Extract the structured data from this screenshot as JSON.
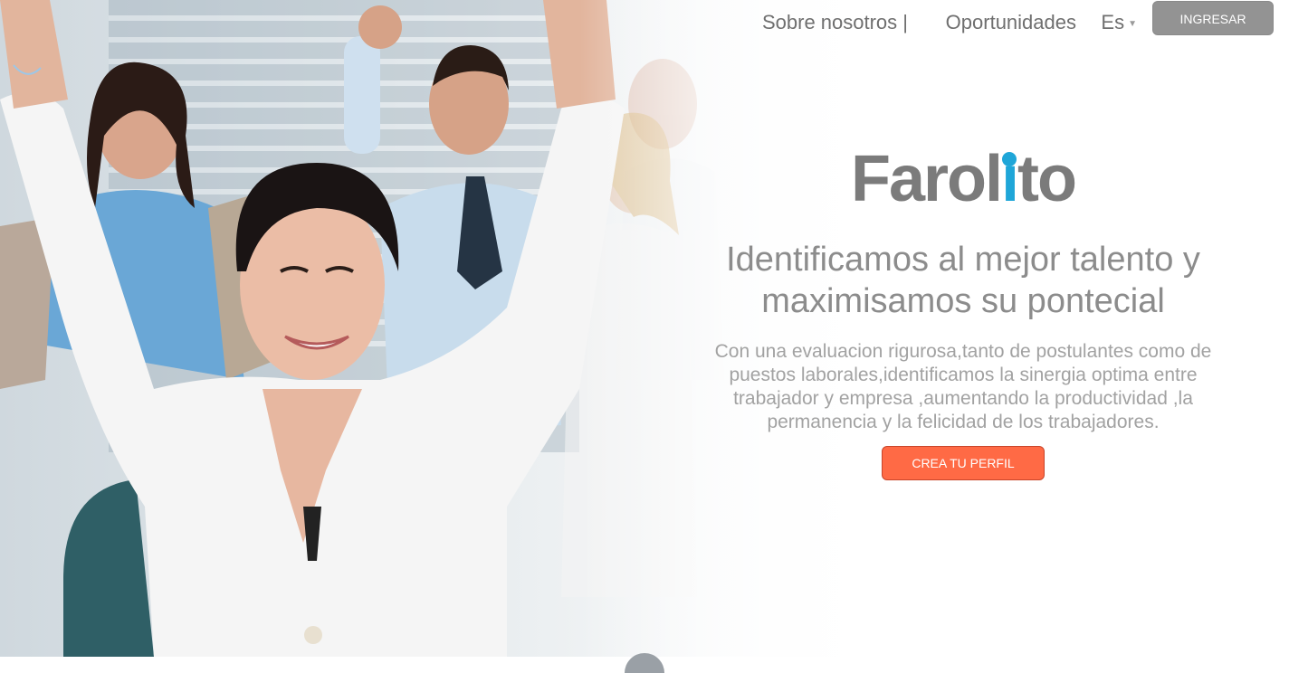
{
  "nav": {
    "about": "Sobre nosotros |",
    "opportunities": "Oportunidades",
    "language": "Es",
    "login": "INGRESAR"
  },
  "hero": {
    "logo_text": "Farolito",
    "logo_prefix": "Farol",
    "logo_i": "ı",
    "logo_suffix": "to",
    "headline_line1": "Identificamos al mejor talento y",
    "headline_line2": "maximisamos su pontecial",
    "description": "Con una evaluacion rigurosa,tanto de postulantes como de puestos laborales,identificamos la sinergia optima entre trabajador y empresa ,aumentando la productividad ,la permanencia y la felicidad de los trabajadores.",
    "cta": "CREA TU PERFIL"
  },
  "colors": {
    "brand": "#1fa6d8",
    "cta": "#ff6a45",
    "login": "#939393",
    "text": "#8c8c8c"
  },
  "icons": [
    "caret-down-icon",
    "scroll-down-icon"
  ]
}
